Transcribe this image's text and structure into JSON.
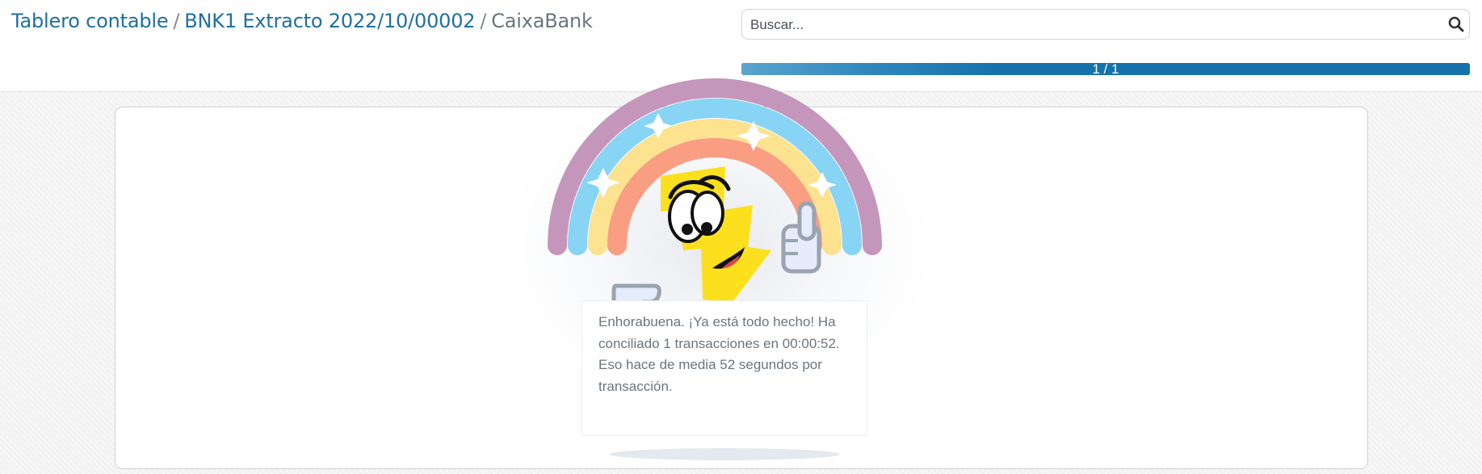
{
  "breadcrumb": {
    "item1": "Tablero contable",
    "item2": "BNK1 Extracto 2022/10/00002",
    "current": "CaixaBank",
    "separator": "/"
  },
  "search": {
    "placeholder": "Buscar...",
    "icon": "search-icon"
  },
  "progress": {
    "label": "1 / 1",
    "fraction": 1.0
  },
  "message": {
    "text": "Enhorabuena. ¡Ya está todo hecho! Ha conciliado 1 transacciones en 00:00:52. Eso hace de media 52 segundos por transacción."
  },
  "colors": {
    "link": "#1f6fa0",
    "current_crumb": "#6c757d",
    "progress": "#1572ab",
    "rainbow": [
      "#c596bb",
      "#87d4f5",
      "#fde28f",
      "#f99d83"
    ],
    "bolt": "#fce01d"
  }
}
